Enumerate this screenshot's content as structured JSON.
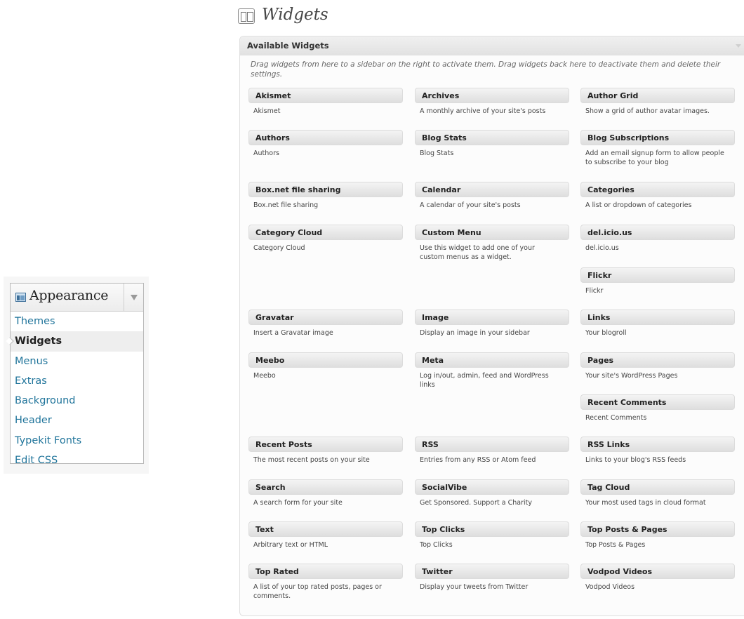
{
  "appearance_menu": {
    "title": "Appearance",
    "items": [
      {
        "label": "Themes"
      },
      {
        "label": "Widgets"
      },
      {
        "label": "Menus"
      },
      {
        "label": "Extras"
      },
      {
        "label": "Background"
      },
      {
        "label": "Header"
      },
      {
        "label": "Typekit Fonts"
      },
      {
        "label": "Edit CSS"
      }
    ],
    "current_item": "Widgets"
  },
  "page": {
    "title": "Widgets"
  },
  "available_widgets": {
    "heading": "Available Widgets",
    "description": "Drag widgets from here to a sidebar on the right to activate them. Drag widgets back here to deactivate them and delete their settings.",
    "columns": [
      [
        {
          "title": "Akismet",
          "desc": "Akismet"
        },
        {
          "title": "Authors",
          "desc": "Authors"
        },
        {
          "title": "Box.net file sharing",
          "desc": "Box.net file sharing"
        },
        {
          "title": "Category Cloud",
          "desc": "Category Cloud"
        },
        {
          "title": "Gravatar",
          "desc": "Insert a Gravatar image"
        },
        {
          "title": "Meebo",
          "desc": "Meebo"
        },
        {
          "title": "Recent Posts",
          "desc": "The most recent posts on your site"
        },
        {
          "title": "Search",
          "desc": "A search form for your site"
        },
        {
          "title": "Text",
          "desc": "Arbitrary text or HTML"
        },
        {
          "title": "Top Rated",
          "desc": "A list of your top rated posts, pages or comments."
        }
      ],
      [
        {
          "title": "Archives",
          "desc": "A monthly archive of your site's posts"
        },
        {
          "title": "Blog Stats",
          "desc": "Blog Stats"
        },
        {
          "title": "Calendar",
          "desc": "A calendar of your site's posts"
        },
        {
          "title": "Custom Menu",
          "desc": "Use this widget to add one of your custom menus as a widget."
        },
        {
          "title": "Image",
          "desc": "Display an image in your sidebar"
        },
        {
          "title": "Meta",
          "desc": "Log in/out, admin, feed and WordPress links"
        },
        {
          "title": "RSS",
          "desc": "Entries from any RSS or Atom feed"
        },
        {
          "title": "SocialVibe",
          "desc": "Get Sponsored. Support a Charity"
        },
        {
          "title": "Top Clicks",
          "desc": "Top Clicks"
        },
        {
          "title": "Twitter",
          "desc": "Display your tweets from Twitter"
        }
      ],
      [
        {
          "title": "Author Grid",
          "desc": "Show a grid of author avatar images."
        },
        {
          "title": "Blog Subscriptions",
          "desc": "Add an email signup form to allow people to subscribe to your blog"
        },
        {
          "title": "Categories",
          "desc": "A list or dropdown of categories"
        },
        {
          "title": "del.icio.us",
          "desc": "del.icio.us"
        },
        {
          "title": "Flickr",
          "desc": "Flickr"
        },
        {
          "title": "Links",
          "desc": "Your blogroll"
        },
        {
          "title": "Pages",
          "desc": "Your site's WordPress Pages"
        },
        {
          "title": "Recent Comments",
          "desc": "Recent Comments"
        },
        {
          "title": "RSS Links",
          "desc": "Links to your blog's RSS feeds"
        },
        {
          "title": "Tag Cloud",
          "desc": "Your most used tags in cloud format"
        },
        {
          "title": "Top Posts & Pages",
          "desc": "Top Posts & Pages"
        },
        {
          "title": "Vodpod Videos",
          "desc": "Vodpod Videos"
        }
      ]
    ]
  },
  "colors": {
    "link": "#21759b",
    "heading": "#464646"
  }
}
